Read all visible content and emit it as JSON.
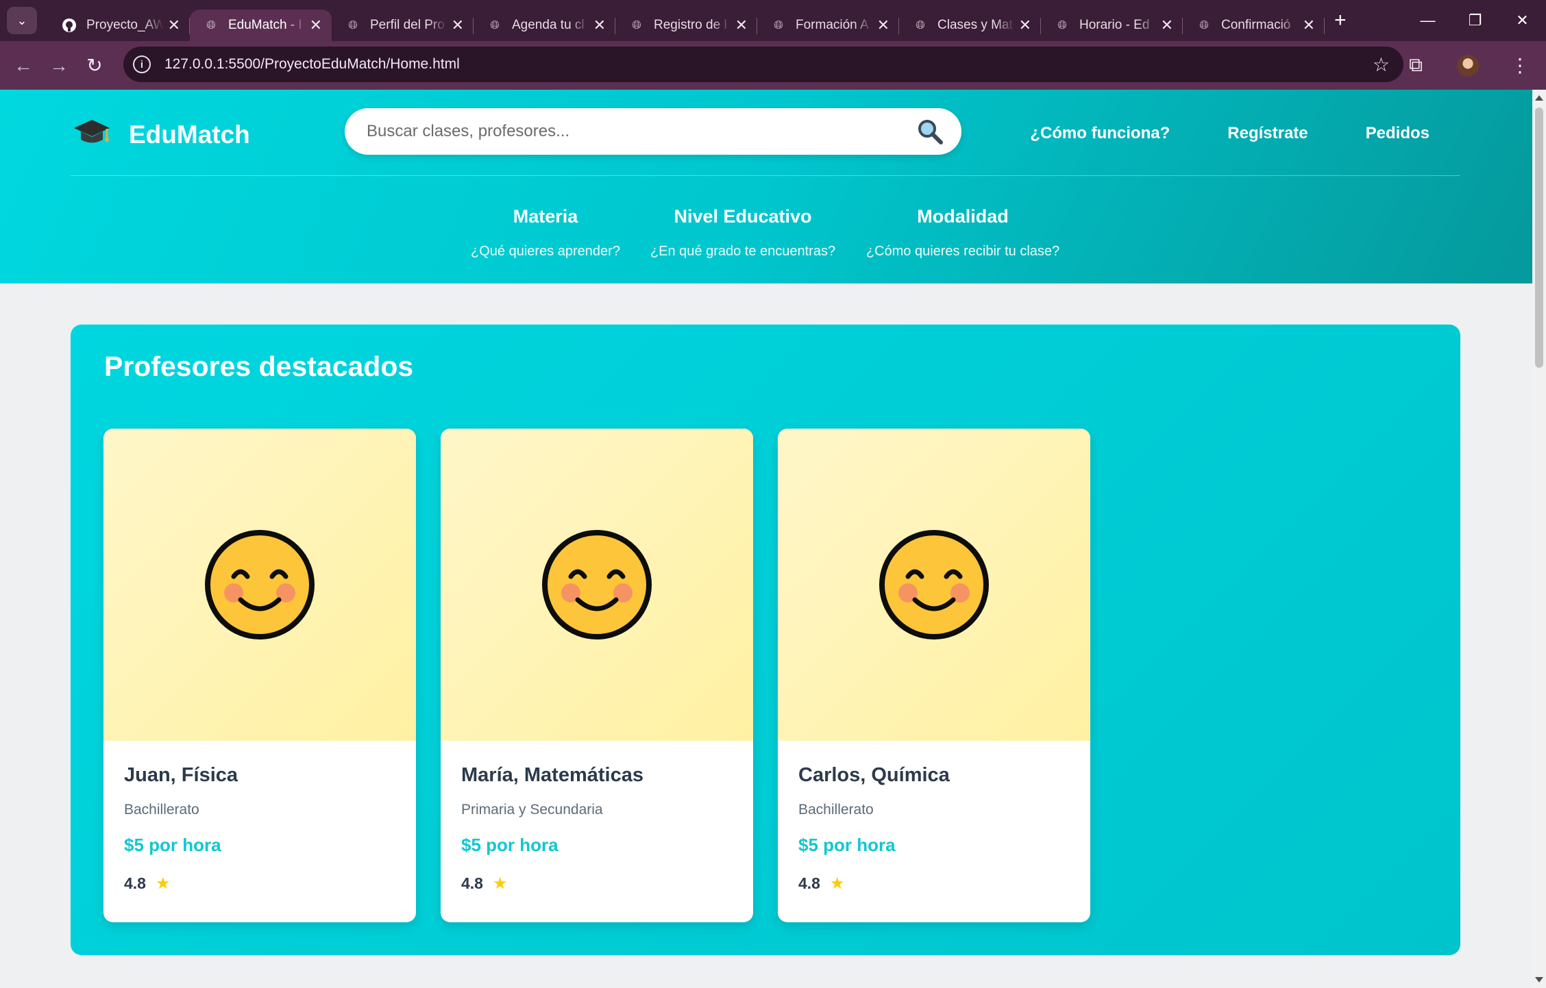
{
  "browser": {
    "tabs": [
      {
        "title": "Proyecto_AW",
        "icon": "github-icon"
      },
      {
        "title": "EduMatch - I",
        "icon": "globe-icon",
        "active": true
      },
      {
        "title": "Perfil del Pro",
        "icon": "globe-icon"
      },
      {
        "title": "Agenda tu cl",
        "icon": "globe-icon"
      },
      {
        "title": "Registro de l",
        "icon": "globe-icon"
      },
      {
        "title": "Formación A",
        "icon": "globe-icon"
      },
      {
        "title": "Clases y Mat",
        "icon": "globe-icon"
      },
      {
        "title": "Horario - Ed",
        "icon": "globe-icon"
      },
      {
        "title": "Confirmació",
        "icon": "globe-icon"
      }
    ],
    "url": "127.0.0.1:5500/ProyectoEduMatch/Home.html"
  },
  "site": {
    "brand": "EduMatch",
    "search_placeholder": "Buscar clases, profesores...",
    "nav": [
      "¿Cómo funciona?",
      "Regístrate",
      "Pedidos"
    ],
    "filters": [
      {
        "title": "Materia",
        "subtitle": "¿Qué quieres aprender?"
      },
      {
        "title": "Nivel Educativo",
        "subtitle": "¿En qué grado te encuentras?"
      },
      {
        "title": "Modalidad",
        "subtitle": "¿Cómo quieres recibir tu clase?"
      }
    ]
  },
  "featured": {
    "heading": "Profesores destacados",
    "teachers": [
      {
        "name": "Juan, Física",
        "level": "Bachillerato",
        "price": "$5 por hora",
        "rating": "4.8",
        "star": "★"
      },
      {
        "name": "María, Matemáticas",
        "level": "Primaria y Secundaria",
        "price": "$5 por hora",
        "rating": "4.8",
        "star": "★"
      },
      {
        "name": "Carlos, Química",
        "level": "Bachillerato",
        "price": "$5 por hora",
        "rating": "4.8",
        "star": "★"
      }
    ]
  },
  "colors": {
    "accent": "#00d2da",
    "price": "#10c8d0",
    "browser_frame": "#5b2f52"
  }
}
